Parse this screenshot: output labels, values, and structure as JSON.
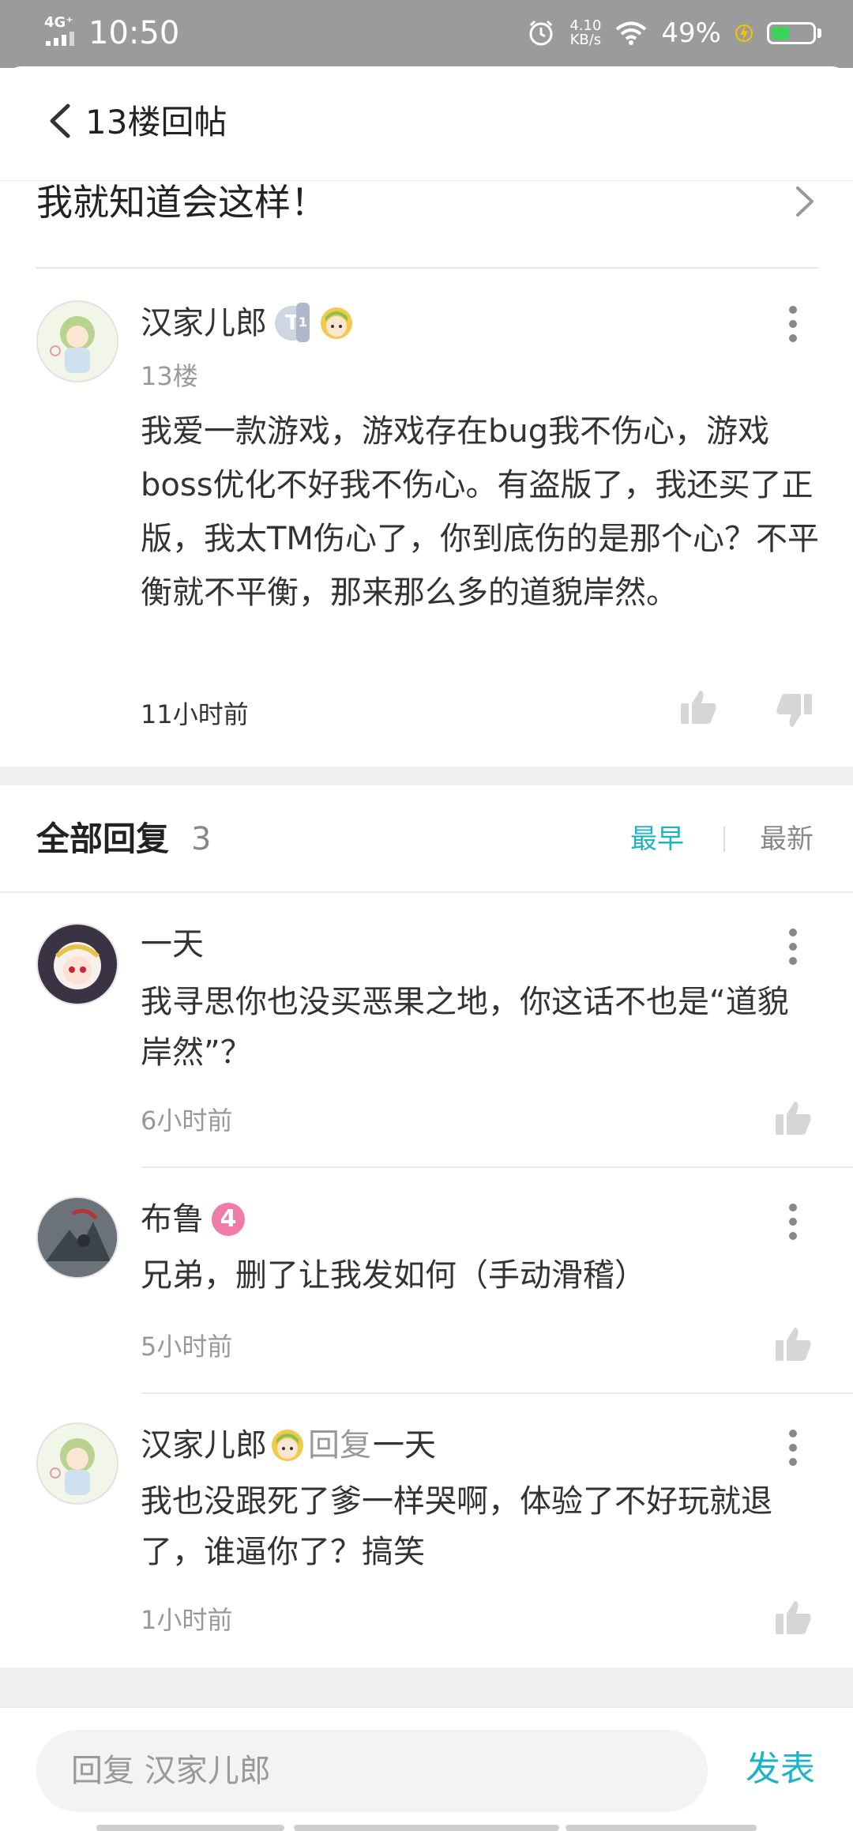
{
  "status_bar": {
    "network": "4G⁺",
    "time": "10:50",
    "speed_value": "4.10",
    "speed_unit": "KB/s",
    "battery": "49%"
  },
  "header": {
    "title": "13楼回帖"
  },
  "topic": {
    "title": "我就知道会这样！"
  },
  "floor_post": {
    "username": "汉家儿郎",
    "badge_t": "T",
    "badge_t_level": "1",
    "floor": "13楼",
    "content": "我爱一款游戏，游戏存在bug我不伤心，游戏boss优化不好我不伤心。有盗版了，我还买了正版，我太TM伤心了，你到底伤的是那个心？不平衡就不平衡，那来那么多的道貌岸然。",
    "time": "11小时前"
  },
  "replies_header": {
    "title": "全部回复",
    "count": "3",
    "sort_earliest": "最早",
    "sort_latest": "最新",
    "accent_color": "#1cb5c7"
  },
  "replies": [
    {
      "username": "一天",
      "content": "我寻思你也没买恶果之地，你这话不也是“道貌岸然”？",
      "time": "6小时前"
    },
    {
      "username": "布鲁",
      "level": "4",
      "content": "兄弟，删了让我发如何（手动滑稽）",
      "time": "5小时前"
    },
    {
      "username": "汉家儿郎",
      "reply_label": "回复",
      "reply_target": "一天",
      "content": "我也没跟死了爹一样哭啊，体验了不好玩就退了，谁逼你了？搞笑",
      "time": "1小时前"
    }
  ],
  "bottom": {
    "placeholder": "回复 汉家儿郎",
    "post_label": "发表"
  }
}
